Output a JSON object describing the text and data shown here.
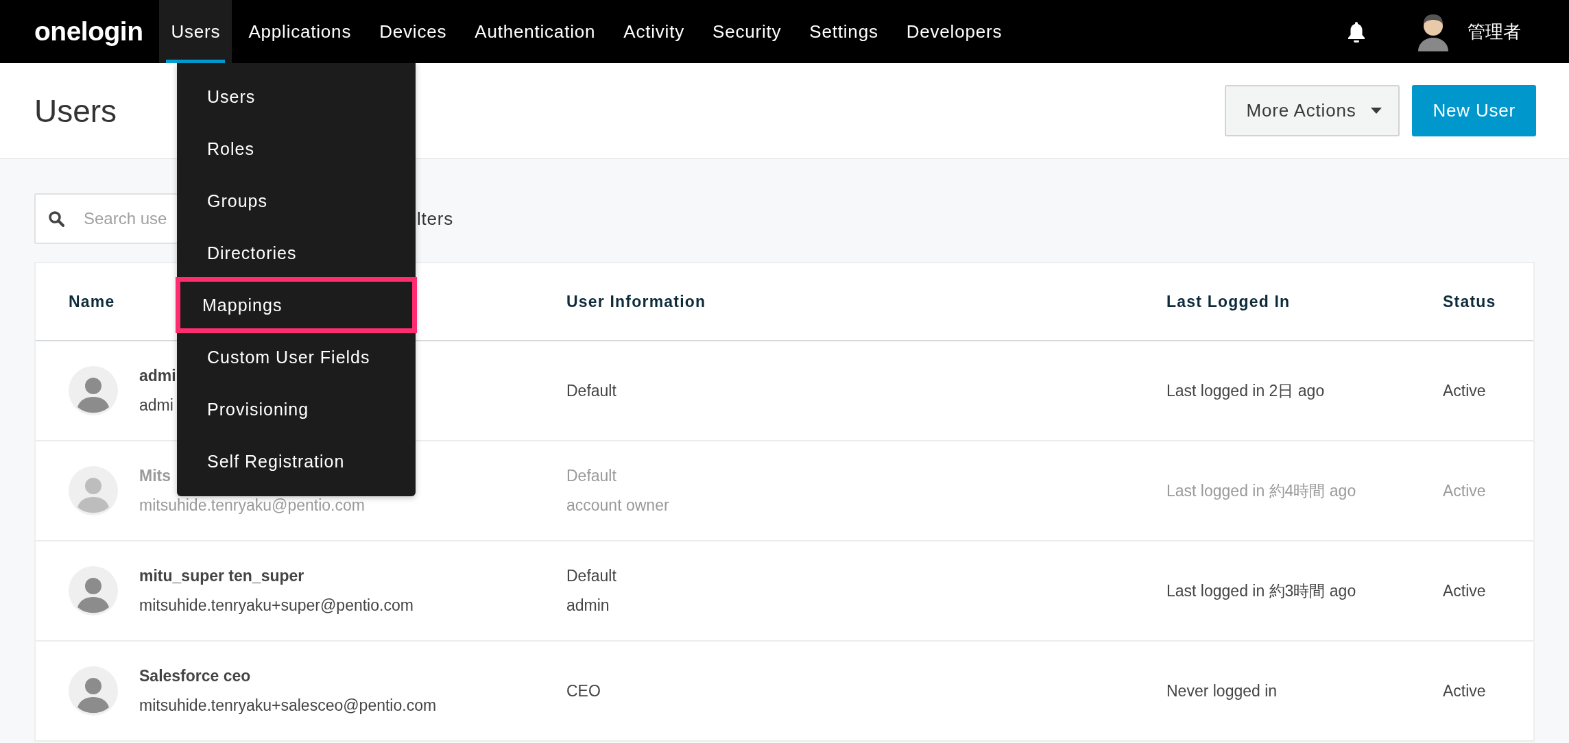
{
  "brand": {
    "logo": "onelogin"
  },
  "nav": [
    {
      "label": "Users",
      "selected": true
    },
    {
      "label": "Applications",
      "selected": false
    },
    {
      "label": "Devices",
      "selected": false
    },
    {
      "label": "Authentication",
      "selected": false
    },
    {
      "label": "Activity",
      "selected": false
    },
    {
      "label": "Security",
      "selected": false
    },
    {
      "label": "Settings",
      "selected": false
    },
    {
      "label": "Developers",
      "selected": false
    }
  ],
  "account": {
    "name": "管理者"
  },
  "dropdown": {
    "items": [
      {
        "label": "Users",
        "highlighted": false
      },
      {
        "label": "Roles",
        "highlighted": false
      },
      {
        "label": "Groups",
        "highlighted": false
      },
      {
        "label": "Directories",
        "highlighted": false
      },
      {
        "label": "Mappings",
        "highlighted": true
      },
      {
        "label": "Custom User Fields",
        "highlighted": false
      },
      {
        "label": "Provisioning",
        "highlighted": false
      },
      {
        "label": "Self Registration",
        "highlighted": false
      }
    ]
  },
  "page": {
    "title": "Users",
    "buttons": [
      {
        "label": "More Actions",
        "kind": "menu"
      },
      {
        "label": "New User",
        "kind": "primary"
      }
    ]
  },
  "search": {
    "placeholder": "Search use"
  },
  "filters_link": "lters",
  "table": {
    "columns": [
      "Name",
      "User Information",
      "Last Logged In",
      "Status"
    ],
    "rows": [
      {
        "name": "admi",
        "email": "admi",
        "info": [
          "Default"
        ],
        "last_login": "Last logged in 2日 ago",
        "status": "Active",
        "dimmed": false
      },
      {
        "name": "Mits",
        "email": "mitsuhide.tenryaku@pentio.com",
        "info": [
          "Default",
          "account owner"
        ],
        "last_login": "Last logged in 約4時間 ago",
        "status": "Active",
        "dimmed": true
      },
      {
        "name": "mitu_super ten_super",
        "email": "mitsuhide.tenryaku+super@pentio.com",
        "info": [
          "Default",
          "admin"
        ],
        "last_login": "Last logged in 約3時間 ago",
        "status": "Active",
        "dimmed": false
      },
      {
        "name": "Salesforce ceo",
        "email": "mitsuhide.tenryaku+salesceo@pentio.com",
        "info": [
          "CEO"
        ],
        "last_login": "Never logged in",
        "status": "Active",
        "dimmed": false
      }
    ]
  }
}
